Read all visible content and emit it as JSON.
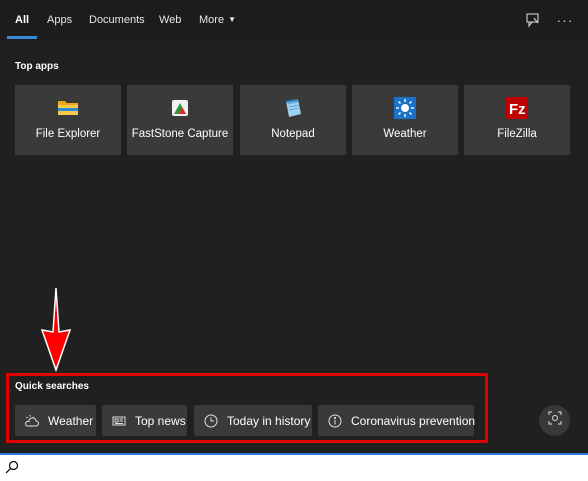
{
  "tabs": [
    {
      "label": "All",
      "active": true
    },
    {
      "label": "Apps"
    },
    {
      "label": "Documents"
    },
    {
      "label": "Web"
    },
    {
      "label": "More"
    }
  ],
  "header_icons": [
    "feedback-icon",
    "more-options-icon"
  ],
  "more_options_glyph": "···",
  "top_apps": {
    "title": "Top apps",
    "items": [
      {
        "label": "File Explorer",
        "icon": "file-explorer-icon"
      },
      {
        "label": "FastStone Capture",
        "icon": "faststone-capture-icon"
      },
      {
        "label": "Notepad",
        "icon": "notepad-icon"
      },
      {
        "label": "Weather",
        "icon": "weather-app-icon"
      },
      {
        "label": "FileZilla",
        "icon": "filezilla-icon"
      }
    ]
  },
  "quick_searches": {
    "title": "Quick searches",
    "items": [
      {
        "label": "Weather",
        "icon": "weather-cloud-icon"
      },
      {
        "label": "Top news",
        "icon": "news-icon"
      },
      {
        "label": "Today in history",
        "icon": "clock-icon"
      },
      {
        "label": "Coronavirus prevention",
        "icon": "info-icon"
      }
    ]
  },
  "search": {
    "value": "",
    "placeholder": ""
  },
  "colors": {
    "accent": "#3b89d6",
    "annotation_red": "#e00000",
    "tile_bg": "#3a3a3a",
    "panel_bg": "#202020"
  }
}
